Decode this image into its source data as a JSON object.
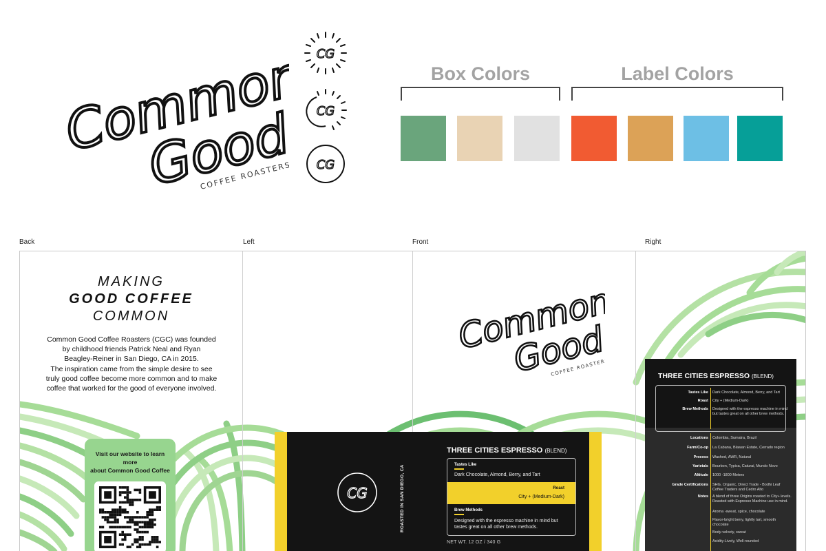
{
  "brand": {
    "logo_line1": "Common",
    "logo_line2": "Good",
    "tagline": "COFFEE ROASTERS",
    "monogram": "CG"
  },
  "palette": {
    "box_title": "Box Colors",
    "label_title": "Label Colors",
    "box_colors": [
      "#6aa57c",
      "#e9d3b4",
      "#e1e1e1"
    ],
    "label_colors": [
      "#f15b32",
      "#dca257",
      "#6dbfe5",
      "#069f98"
    ]
  },
  "panels": {
    "back": "Back",
    "left": "Left",
    "front": "Front",
    "right": "Right"
  },
  "back_panel": {
    "headline_1": "MAKING",
    "headline_2": "GOOD COFFEE",
    "headline_3": "COMMON",
    "story_lines": [
      "Common Good Coffee Roasters (CGC) was founded",
      "by childhood friends Patrick Neal and Ryan",
      "Beagley-Reiner in San Diego, CA in 2015.",
      "The inspiration came from the simple desire to see",
      "truly good coffee become more common and to make",
      "coffee that worked for the good of everyone involved."
    ],
    "qr_line1": "Visit our website to learn more",
    "qr_line2": "about Common Good Coffee"
  },
  "front_label": {
    "location_vertical": "ROASTED IN SAN DIEGO, CA",
    "title": "THREE CITIES ESPRESSO",
    "title_suffix": "(BLEND)",
    "tastes_like_label": "Tastes Like",
    "tastes_like": "Dark Chocolate, Almond, Berry, and Tart",
    "roast_label": "Roast",
    "roast": "City + (Medium-Dark)",
    "brew_label": "Brew Methods",
    "brew_1": "Designed with the espresso machine in mind but",
    "brew_2": "tastes great on all other brew methods.",
    "net_weight": "NET WT. 12 OZ / 340 G"
  },
  "right_panel": {
    "title": "THREE CITIES ESPRESSO",
    "title_suffix": "(BLEND)",
    "rows_top": [
      {
        "k": "Tastes Like",
        "v": "Dark Chocolate, Almond, Berry, and Tart"
      },
      {
        "k": "Roast",
        "v": "City + (Medium-Dark)"
      },
      {
        "k": "Brew Methods",
        "v": "Designed with the espresso machine in mind but tastes great on all other brew methods."
      }
    ],
    "rows_bottom": [
      {
        "k": "Locations",
        "v": "Colombia, Sumatra, Brazil"
      },
      {
        "k": "Farm/Co-op",
        "v": "La Cabana, Blawan Estate, Cerrado region"
      },
      {
        "k": "Process",
        "v": "Washed, AWR, Natural"
      },
      {
        "k": "Varietals",
        "v": "Bourbon, Typica, Caturai, Mundo Novo"
      },
      {
        "k": "Altitude",
        "v": "1000 -1800 Meters"
      },
      {
        "k": "Grade Certifications",
        "v": "SHG, Organic, Direct Trade - Bodhi Leaf Coffee Traders and Cedro Alto"
      },
      {
        "k": "Notes",
        "v": "A blend of three Origins roasted to City+ levels. Roasted with Espresso Machine use in mind."
      }
    ],
    "notes_extra": [
      "Aroma -sweat, spice, chocolate",
      "Flavor-bright berry, lightly tart, smooth chocolate",
      "Body-velvety, sweat",
      "Acidity-Lively, Well-rounded"
    ]
  }
}
